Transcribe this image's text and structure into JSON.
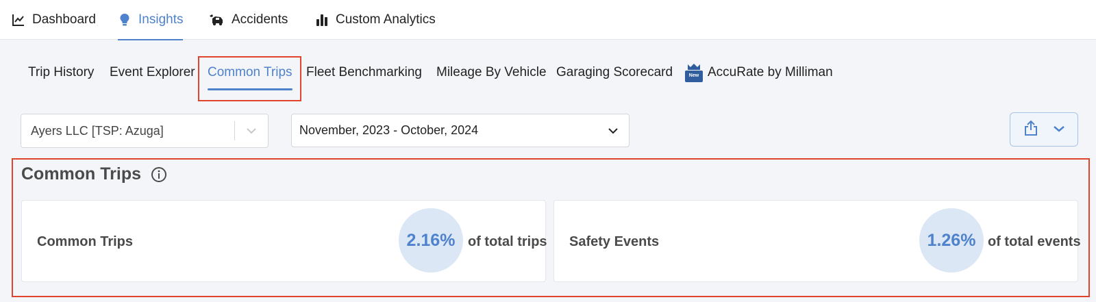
{
  "topnav": {
    "items": [
      {
        "label": "Dashboard",
        "icon": "line-chart-icon"
      },
      {
        "label": "Insights",
        "icon": "lightbulb-icon"
      },
      {
        "label": "Accidents",
        "icon": "car-crash-icon"
      },
      {
        "label": "Custom Analytics",
        "icon": "bar-chart-icon"
      }
    ],
    "active": "Insights"
  },
  "subtabs": {
    "items": [
      {
        "label": "Trip History"
      },
      {
        "label": "Event Explorer"
      },
      {
        "label": "Common Trips"
      },
      {
        "label": "Fleet Benchmarking"
      },
      {
        "label": "Mileage By Vehicle"
      },
      {
        "label": "Garaging Scorecard"
      },
      {
        "label": "AccuRate by Milliman",
        "badge": "New"
      }
    ],
    "active": "Common Trips"
  },
  "filters": {
    "company": "Ayers LLC [TSP: Azuga]",
    "date_range": "November, 2023 - October, 2024"
  },
  "section": {
    "title": "Common Trips"
  },
  "cards": [
    {
      "label": "Common Trips",
      "value": "2.16%",
      "suffix": "of total trips"
    },
    {
      "label": "Safety Events",
      "value": "1.26%",
      "suffix": "of total events"
    }
  ],
  "colors": {
    "accent": "#4f82cc",
    "highlight": "#e0442d",
    "circle_bg": "#dce7f5"
  }
}
